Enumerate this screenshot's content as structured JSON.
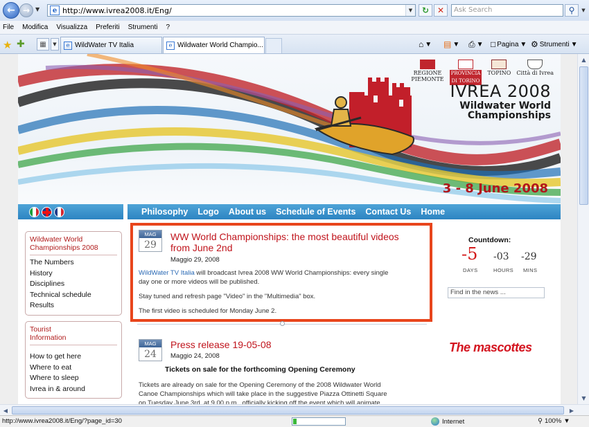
{
  "browser": {
    "url": "http://www.ivrea2008.it/Eng/",
    "search_placeholder": "Ask Search",
    "menu": [
      "File",
      "Modifica",
      "Visualizza",
      "Preferiti",
      "Strumenti",
      "?"
    ],
    "tabs": [
      {
        "label": "WildWater TV Italia",
        "active": false
      },
      {
        "label": "Wildwater World Champio...",
        "active": true
      }
    ],
    "commands": {
      "page": "Pagina",
      "tools": "Strumenti"
    },
    "status": {
      "text": "http://www.ivrea2008.it/Eng/?page_id=30",
      "zone": "Internet",
      "zoom": "100%",
      "progress": 0.06
    }
  },
  "site": {
    "sponsors": [
      {
        "name": "REGIONE PIEMONTE",
        "line1": "REGIONE",
        "line2": "PIEMONTE"
      },
      {
        "name": "PROVINCIA DI TORINO",
        "line1": "PROVINCIA",
        "line2": "DI TORINO"
      },
      {
        "name": "TOPINO",
        "line1": "TOPINO",
        "line2": ""
      },
      {
        "name": "Città di Ivrea",
        "line1": "Città di Ivrea",
        "line2": ""
      }
    ],
    "event": {
      "title": "IVREA 2008",
      "subtitle_line1": "Wildwater World",
      "subtitle_line2": "Championships",
      "dates": "3 - 8 June 2008"
    },
    "nav": [
      "Philosophy",
      "Logo",
      "About us",
      "Schedule of Events",
      "Contact Us",
      "Home"
    ],
    "sidebar": {
      "box1": {
        "title_line1": "Wildwater World",
        "title_line2": "Championships 2008",
        "items": [
          "The Numbers",
          "History",
          "Disciplines",
          "Technical schedule",
          "Results"
        ]
      },
      "box2": {
        "title_line1": "Tourist",
        "title_line2": "Information",
        "items": [
          "How to get here",
          "Where to eat",
          "Where to sleep",
          "Ivrea in & around"
        ]
      }
    },
    "posts": [
      {
        "month": "MAG",
        "day": "29",
        "title_line1": "WW World Championships: the most beautiful videos",
        "title_line2": "from June 2nd",
        "date": "Maggio 29, 2008",
        "link_text": "WildWater TV Italia",
        "body1_rest": " will broadcast Ivrea 2008 WW World Championships: every single",
        "body1_line2": "day one or more videos will be published.",
        "body2": "Stay tuned and refresh page \"Video\" in the \"Multimedia\" box.",
        "body3": "The first video is scheduled for Monday June 2."
      },
      {
        "month": "MAG",
        "day": "24",
        "title": "Press release 19-05-08",
        "date": "Maggio 24, 2008",
        "subtitle": "Tickets on sale for the forthcoming Opening Ceremony",
        "body_line1": "Tickets are already on sale for the Opening Ceremony of the 2008 Wildwater World",
        "body_line2": "Canoe Championships which will take place in the suggestive Piazza Ottinetti Square",
        "body_line3": "on Tuesday June 3rd, at 9.00 p.m., officially kicking off the event which will animate"
      }
    ],
    "countdown": {
      "title": "Countdown:",
      "days": "-5",
      "hours": "-03",
      "mins": "-29",
      "days_label": "DAYS",
      "hours_label": "HOURS",
      "mins_label": "MINS"
    },
    "news_search_placeholder": "Find in the news ...",
    "mascottes": "The mascottes"
  },
  "colors": {
    "accent_red": "#c0141c",
    "nav_blue": "#3a92cd",
    "highlight_orange": "#e8451c"
  }
}
